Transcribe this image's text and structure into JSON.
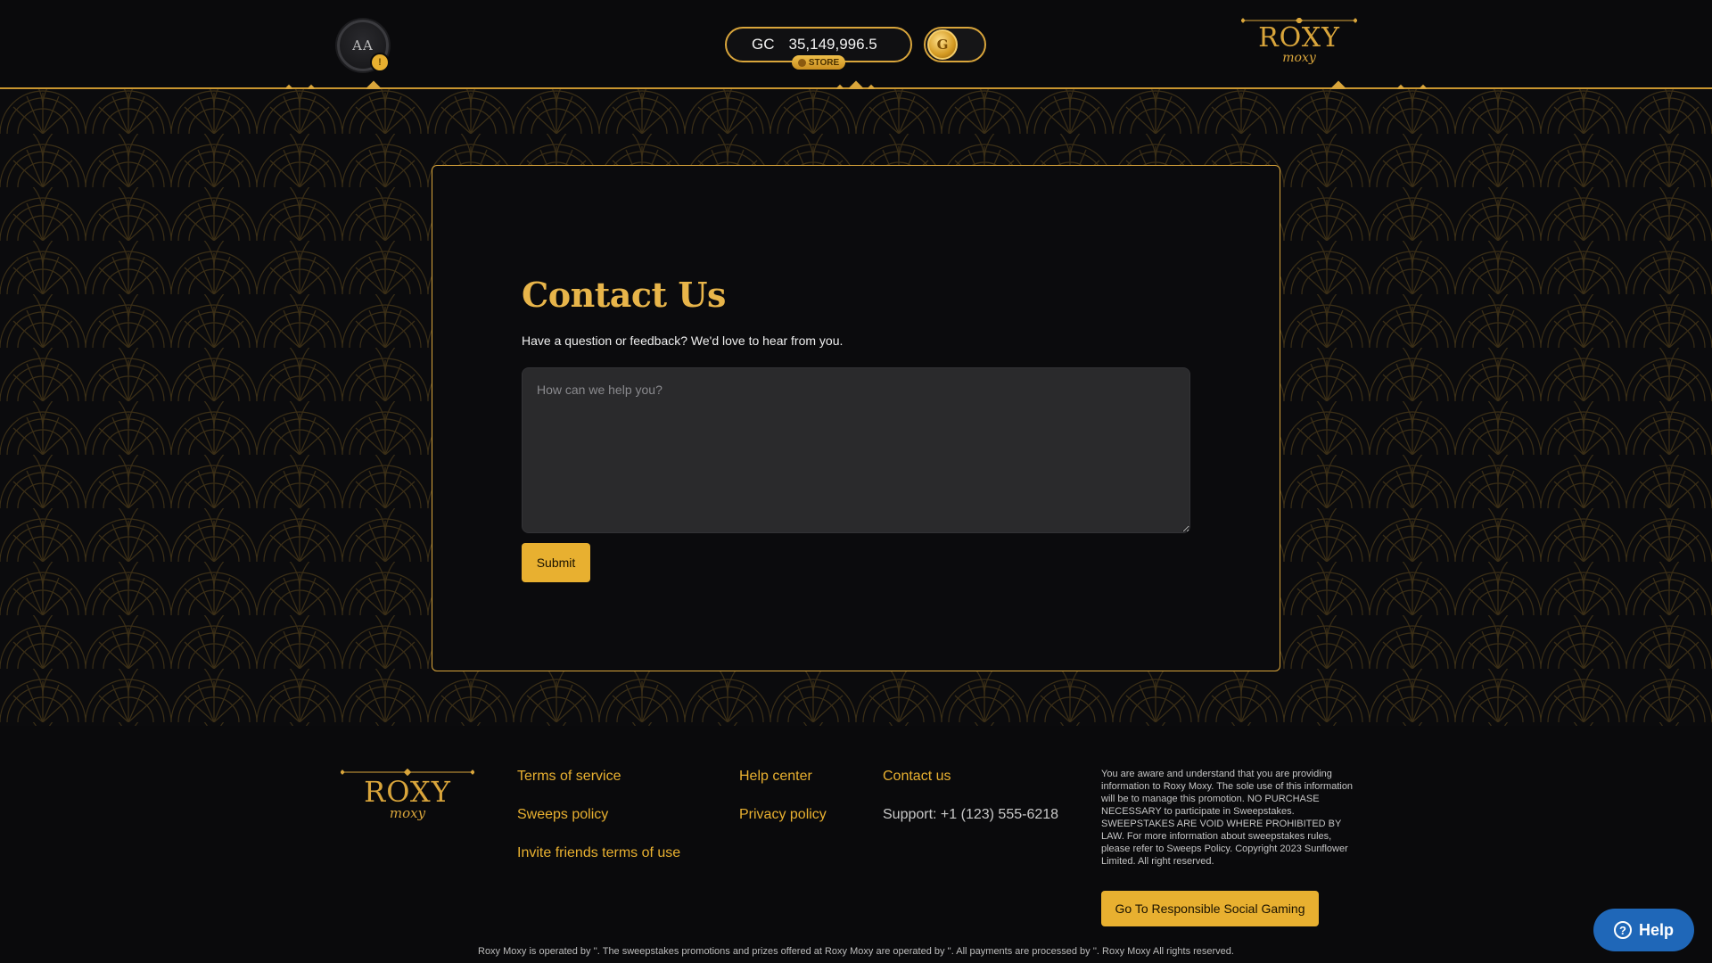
{
  "header": {
    "avatar_initials": "AA",
    "avatar_badge": "!",
    "currency": "GC",
    "balance": "35,149,996.5",
    "store_label": "STORE",
    "coin_symbol": "G",
    "logo_main": "ROXY",
    "logo_sub": "moxy"
  },
  "contact": {
    "title": "Contact Us",
    "subtitle": "Have a question or feedback? We'd love to hear from you.",
    "message_placeholder": "How can we help you?",
    "message_value": "",
    "submit_label": "Submit"
  },
  "footer": {
    "logo_main": "ROXY",
    "logo_sub": "moxy",
    "links": {
      "terms": "Terms of service",
      "sweeps": "Sweeps policy",
      "invite": "Invite friends terms of use",
      "help_center": "Help center",
      "privacy": "Privacy policy",
      "contact": "Contact us"
    },
    "support": "Support: +1 (123) 555-6218",
    "disclaimer": "You are aware and understand that you are providing information to Roxy Moxy. The sole use of this information will be to manage this promotion. NO PURCHASE NECESSARY to participate in Sweepstakes. SWEEPSTAKES ARE VOID WHERE PROHIBITED BY LAW. For more information about sweepstakes rules, please refer to Sweeps Policy. Copyright 2023 Sunflower Limited. All right reserved.",
    "rsg_button": "Go To Responsible Social Gaming",
    "bottom_note": "Roxy Moxy is operated by ''. The sweepstakes promotions and prizes offered at Roxy Moxy are operated by ''. All payments are processed by ''. Roxy Moxy All rights reserved."
  },
  "help_widget": {
    "label": "Help",
    "icon": "question-circle-icon"
  },
  "colors": {
    "accent": "#e8b030",
    "gold_line": "#c8952f",
    "background": "#0a0a0c",
    "help_blue": "#1f67b8"
  }
}
